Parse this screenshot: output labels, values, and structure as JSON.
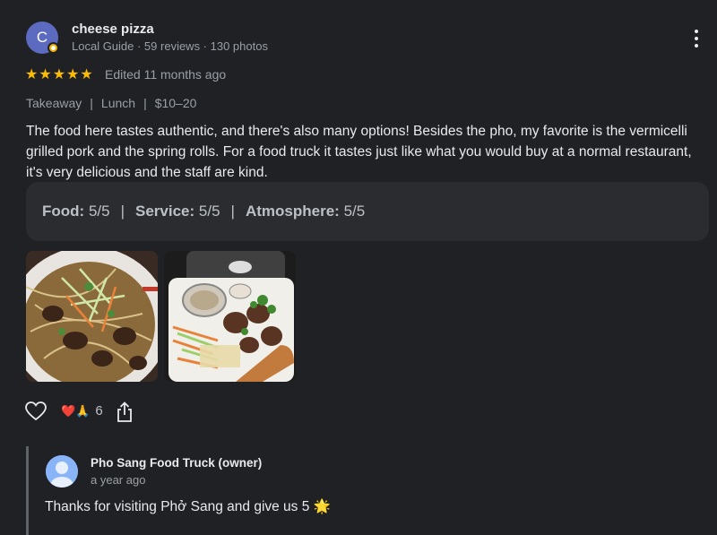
{
  "reviewer": {
    "initial": "C",
    "name": "cheese pizza",
    "meta": "Local Guide · 59 reviews · 130 photos"
  },
  "rating": {
    "stars": 5,
    "stars_glyph": "★★★★★",
    "edited": "Edited 11 months ago"
  },
  "tags": [
    "Takeaway",
    "Lunch",
    "$10–20"
  ],
  "review_text": "The food here tastes authentic, and there's also many options! Besides the pho, my favorite is the vermicelli grilled pork and the spring rolls. For a food truck it tastes just like what you would buy at a normal restaurant, it's very delicious and the staff are kind.",
  "sub_ratings": [
    {
      "label": "Food:",
      "value": "5/5"
    },
    {
      "label": "Service:",
      "value": "5/5"
    },
    {
      "label": "Atmosphere:",
      "value": "5/5"
    }
  ],
  "photos": [
    {
      "name": "vermicelli-bowl-photo"
    },
    {
      "name": "takeout-box-photo"
    }
  ],
  "actions": {
    "reactions": "❤️🙏",
    "reaction_count": "6"
  },
  "owner_reply": {
    "name": "Pho Sang Food Truck (owner)",
    "time": "a year ago",
    "text": "Thanks for visiting Phở Sang and give us 5 🌟"
  },
  "colors": {
    "background": "#202124",
    "star": "#fbbc04",
    "avatar": "#5c6bc0",
    "box": "#2b2c2f"
  }
}
